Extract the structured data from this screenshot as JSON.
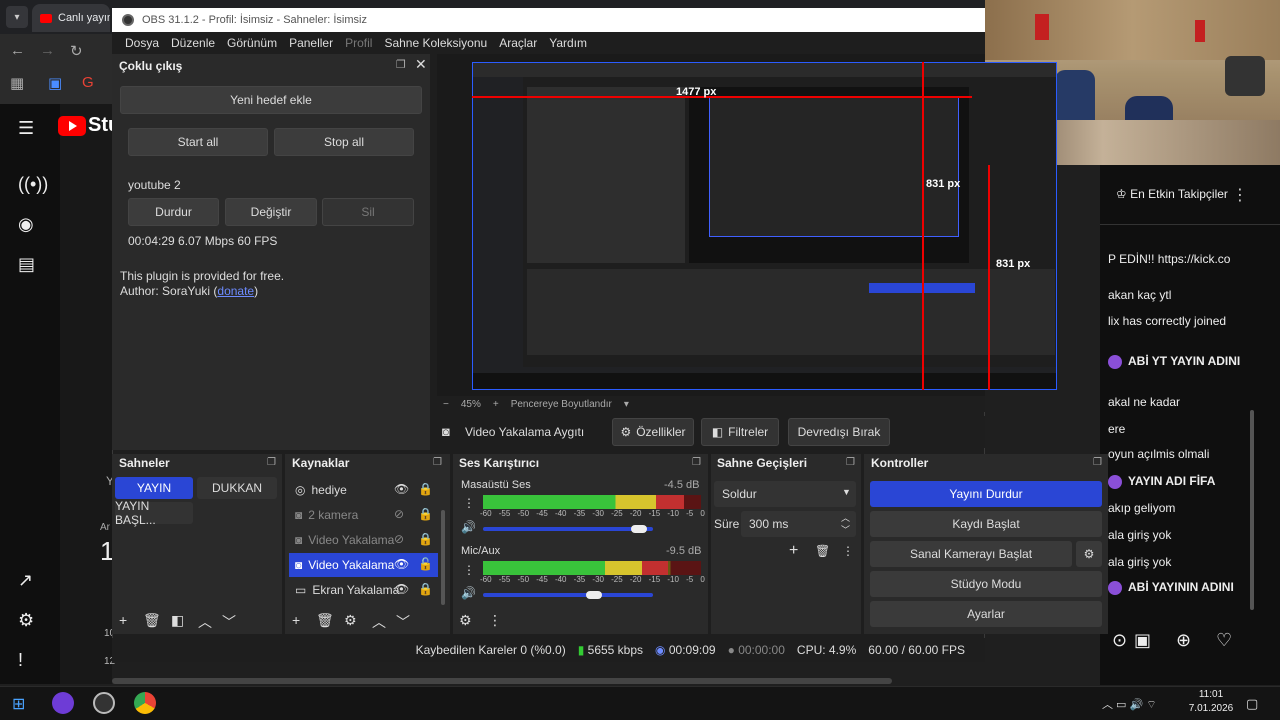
{
  "chrome": {
    "tab_title": "Canlı yayın"
  },
  "youtube": {
    "logo_text": "Stu"
  },
  "obs": {
    "title": "OBS 31.1.2 - Profil: İsimsiz - Sahneler: İsimsiz",
    "menu": [
      "Dosya",
      "Düzenle",
      "Görünüm",
      "Paneller",
      "Profil",
      "Sahne Koleksiyonu",
      "Araçlar",
      "Yardım"
    ],
    "multi_output": {
      "title": "Çoklu çıkış",
      "add_target": "Yeni hedef ekle",
      "start_all": "Start all",
      "stop_all": "Stop all",
      "target_name": "youtube 2",
      "stop": "Durdur",
      "change": "Değiştir",
      "delete": "Sil",
      "stats": "00:04:29  6.07 Mbps  60 FPS",
      "free_note": "This plugin is provided for free.",
      "author": "Author: SoraYuki (",
      "donate": "donate",
      "author_close": ")"
    },
    "preview": {
      "label_1477": "1477 px",
      "label_831a": "831 px",
      "label_831b": "831 px",
      "zoom": "45%",
      "resize": "Pencereye Boyutlandır"
    },
    "source_bar": {
      "name": "Video Yakalama Aygıtı",
      "props": "Özellikler",
      "filters": "Filtreler",
      "disable": "Devredışı Bırak"
    },
    "scenes": {
      "title": "Sahneler",
      "items": [
        "YAYIN",
        "DUKKAN",
        "YAYIN BAŞL..."
      ]
    },
    "sources": {
      "title": "Kaynaklar",
      "items": [
        "hediye",
        "2 kamera",
        "Video Yakalama",
        "Video Yakalama",
        "Ekran Yakalama"
      ]
    },
    "mixer": {
      "title": "Ses Karıştırıcı",
      "ch1": {
        "name": "Masaüstü Ses",
        "db": "-4.5 dB",
        "level": 0.92,
        "volume": 0.92
      },
      "ch2": {
        "name": "Mic/Aux",
        "db": "-9.5 dB",
        "level": 0.85,
        "volume": 0.65
      },
      "scale": [
        "-60",
        "-55",
        "-50",
        "-45",
        "-40",
        "-35",
        "-30",
        "-25",
        "-20",
        "-15",
        "-10",
        "-5",
        "0"
      ]
    },
    "transitions": {
      "title": "Sahne Geçişleri",
      "type": "Soldur",
      "duration_label": "Süre",
      "duration": "300 ms"
    },
    "controls": {
      "title": "Kontroller",
      "stop_stream": "Yayını Durdur",
      "start_rec": "Kaydı Başlat",
      "virtual_cam": "Sanal Kamerayı Başlat",
      "studio": "Stüdyo Modu",
      "settings": "Ayarlar"
    },
    "status": {
      "dropped": "Kaybedilen Kareler 0 (%0.0)",
      "bitrate": "5655 kbps",
      "stream_time": "00:09:09",
      "rec_time": "00:00:00",
      "cpu": "CPU: 4.9%",
      "fps": "60.00 / 60.00 FPS"
    }
  },
  "chat": {
    "header": "En Etkin Takipçiler",
    "lines": [
      {
        "text": "P EDİN!! https://kick.co",
        "avatar": false
      },
      {
        "text": "akan kaç ytl",
        "avatar": false
      },
      {
        "text": "lix has correctly joined",
        "avatar": false
      },
      {
        "text": "ABİ YT YAYIN ADINI",
        "avatar": true
      },
      {
        "text": "akal ne kadar",
        "avatar": false
      },
      {
        "text": "ere",
        "avatar": false
      },
      {
        "text": "oyun açılmis olmali",
        "avatar": false
      },
      {
        "text": "YAYIN ADI FİFA",
        "avatar": true
      },
      {
        "text": "akıp geliyom",
        "avatar": false
      },
      {
        "text": "ala giriş yok",
        "avatar": false
      },
      {
        "text": "ala giriş yok",
        "avatar": false
      },
      {
        "text": "ABİ YAYININ ADINI",
        "avatar": true
      }
    ]
  },
  "left_partial": {
    "a": "Y",
    "b": "Ar",
    "c": "1",
    "d": "10",
    "e": "12"
  },
  "taskbar": {
    "time": "11:01",
    "date": "7.01.2026"
  }
}
